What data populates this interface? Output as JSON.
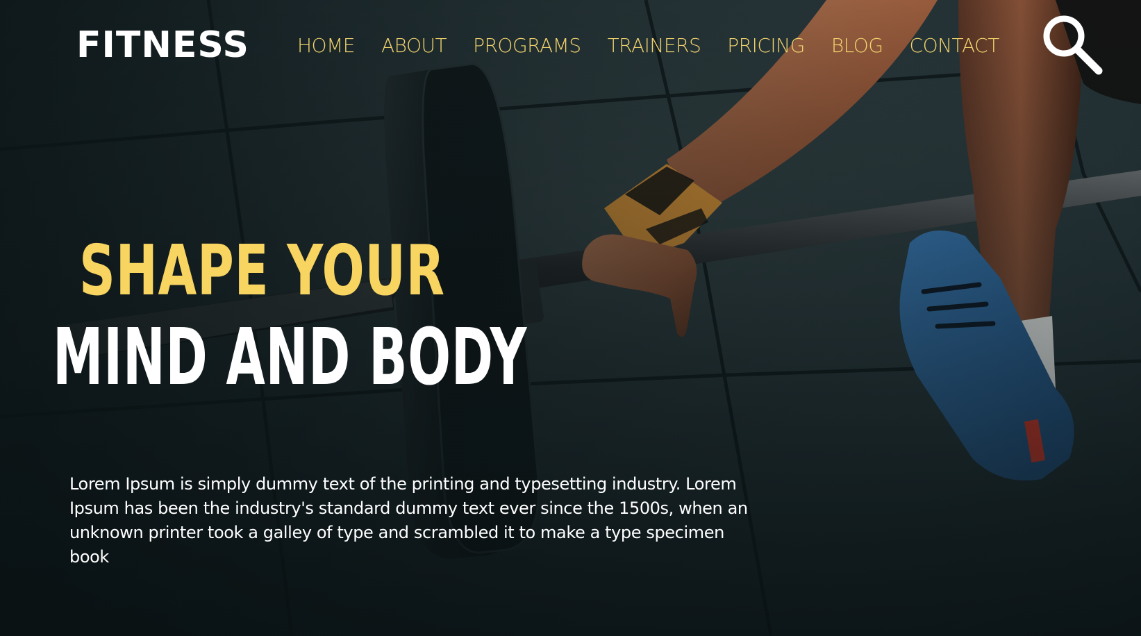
{
  "site": {
    "logo": "FITNESS"
  },
  "nav": {
    "items": [
      {
        "label": "HOME"
      },
      {
        "label": "ABOUT"
      },
      {
        "label": "PROGRAMS"
      },
      {
        "label": "TRAINERS"
      },
      {
        "label": "PRICING"
      },
      {
        "label": "BLOG"
      },
      {
        "label": "CONTACT"
      }
    ]
  },
  "search": {
    "icon": "search-icon"
  },
  "hero": {
    "headline_line1": "SHAPE YOUR",
    "headline_line2": "MIND AND BODY",
    "body": "Lorem Ipsum is simply dummy text of the printing and typesetting industry. Lorem Ipsum has been the industry's standard dummy text ever since the 1500s, when an unknown printer took a galley of type and scrambled it to make a type specimen book",
    "background": "photo of athlete gripping a loaded barbell on a rubber gym floor"
  },
  "colors": {
    "accent": "#f8d460",
    "nav_text": "#f2d36e",
    "headline_white": "#ffffff",
    "background": "#1b2629",
    "wrist_wrap": "#f2a23a",
    "shoe": "#2f6fa8"
  }
}
